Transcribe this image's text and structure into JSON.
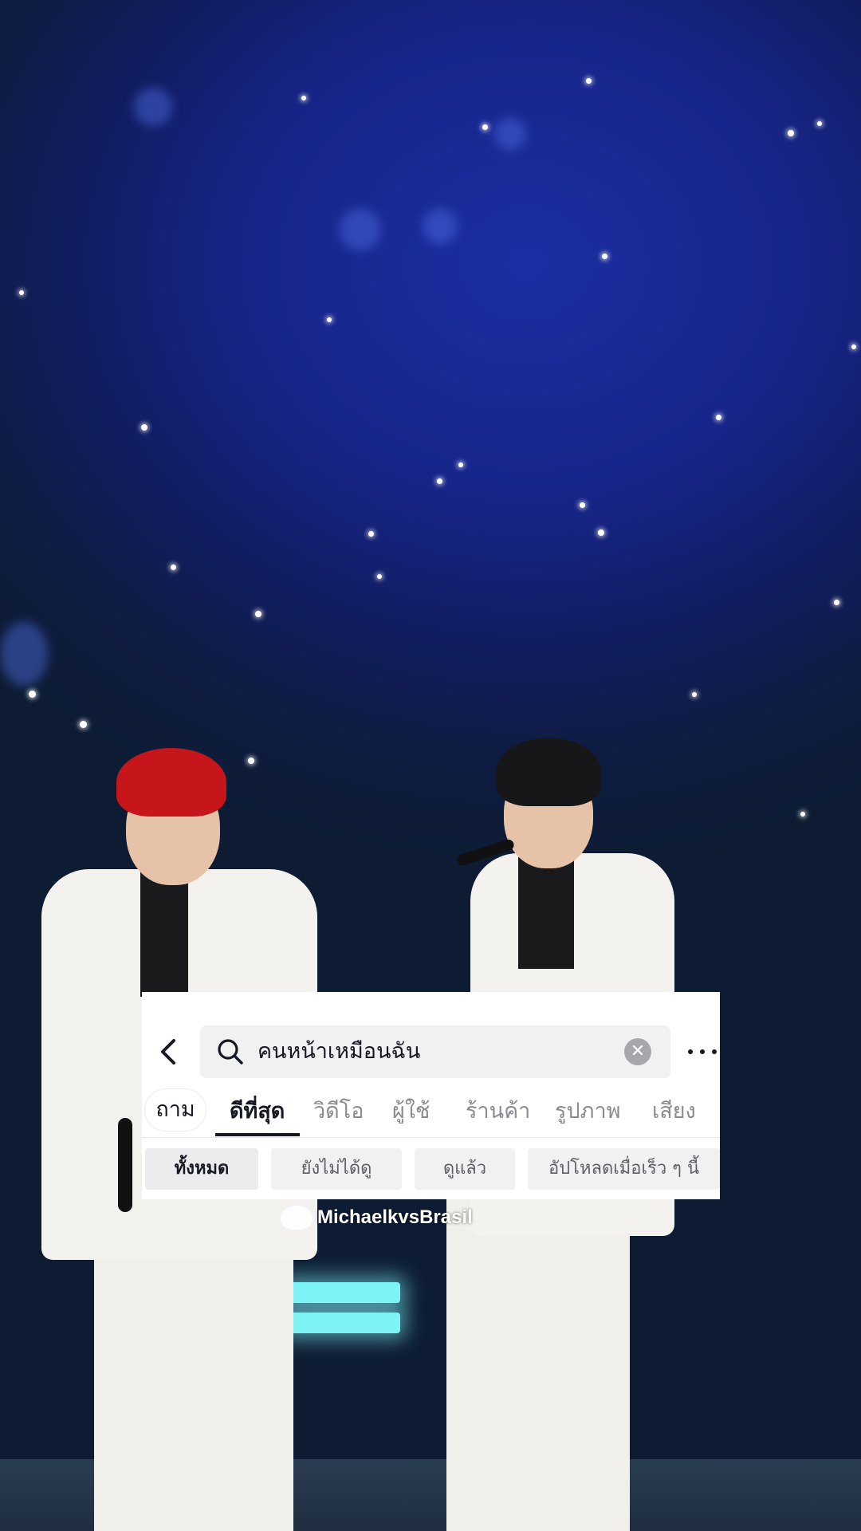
{
  "search": {
    "query": "คนหน้าเหมือนฉัน",
    "back_icon": "chevron-left-icon",
    "search_icon": "search-icon",
    "clear_icon": "close-circle-icon",
    "more_icon": "more-horizontal-icon"
  },
  "tabs": [
    {
      "label": "ถาม"
    },
    {
      "label": "ดีที่สุด"
    },
    {
      "label": "วิดีโอ"
    },
    {
      "label": "ผู้ใช้"
    },
    {
      "label": "ร้านค้า"
    },
    {
      "label": "รูปภาพ"
    },
    {
      "label": "เสียง"
    }
  ],
  "active_tab": "ดีที่สุด",
  "filters": [
    {
      "label": "ทั้งหมด"
    },
    {
      "label": "ยังไม่ได้ดู"
    },
    {
      "label": "ดูแล้ว"
    },
    {
      "label": "อัปโหลดเมื่อเร็ว ๆ นี้"
    }
  ],
  "selected_filter": "ทั้งหมด",
  "watermark": {
    "text": "MichaelkvsBrasil"
  },
  "colors": {
    "sky_blue": "#1b2fa3",
    "stage_cyan": "#7df3f6",
    "text_primary": "#161823",
    "text_secondary": "#8a8b91"
  }
}
